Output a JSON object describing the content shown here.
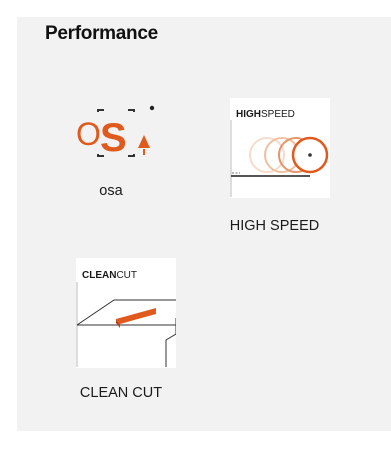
{
  "section": {
    "title": "Performance"
  },
  "features": [
    {
      "label": "osa",
      "icon": "osa-logo-icon",
      "icon_text": {
        "o": "O",
        "s": "S"
      }
    },
    {
      "label": "HIGH SPEED",
      "icon": "high-speed-icon",
      "icon_text": {
        "bold": "HIGH",
        "regular": "SPEED"
      }
    },
    {
      "label": "CLEAN CUT",
      "icon": "clean-cut-icon",
      "icon_text": {
        "bold": "CLEAN",
        "regular": "CUT"
      }
    }
  ],
  "colors": {
    "accent": "#e05a1e",
    "panel_background": "#f2f2f2",
    "text": "#1a1a1a"
  }
}
